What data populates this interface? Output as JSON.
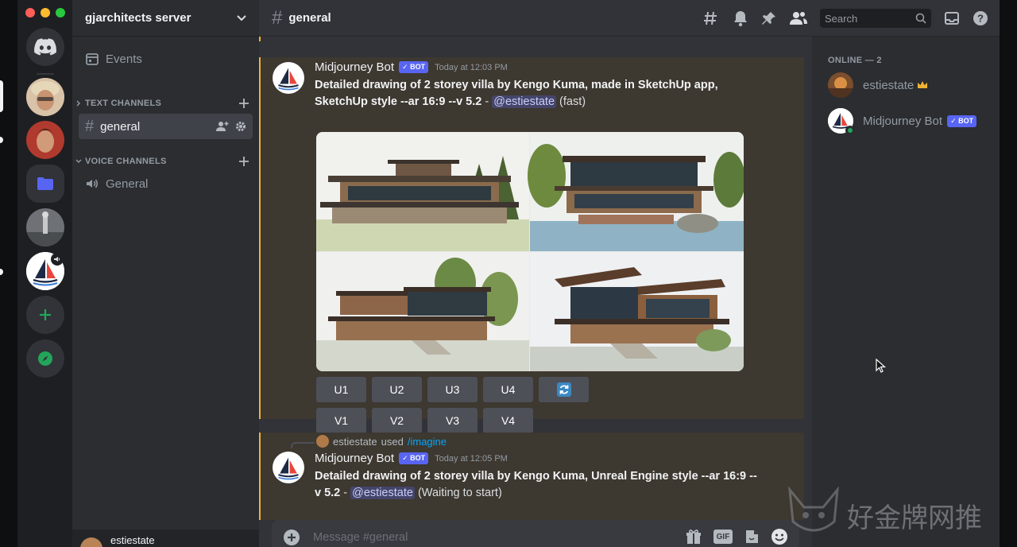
{
  "server": {
    "name": "gjarchitects server",
    "events_label": "Events",
    "text_category": "TEXT CHANNELS",
    "voice_category": "VOICE CHANNELS",
    "text_channels": [
      "general"
    ],
    "voice_channels": [
      "General"
    ]
  },
  "header": {
    "channel": "general",
    "search_placeholder": "Search"
  },
  "messages": [
    {
      "author": "Midjourney Bot",
      "bot_tag": "✓ BOT",
      "time": "Today at 12:03 PM",
      "prompt_line1": "Detailed drawing of 2 storey villa by Kengo Kuma, made in SketchUp app,",
      "prompt_line2": "SketchUp style --ar 16:9 --v 5.2",
      "sep": " - ",
      "mention": "@estiestate",
      "suffix": " (fast)",
      "upscale_buttons": [
        "U1",
        "U2",
        "U3",
        "U4"
      ],
      "variation_buttons": [
        "V1",
        "V2",
        "V3",
        "V4"
      ]
    },
    {
      "reply_user": "estiestate",
      "reply_used": "used",
      "reply_command": "/imagine",
      "author": "Midjourney Bot",
      "bot_tag": "✓ BOT",
      "time": "Today at 12:05 PM",
      "prompt_line1": "Detailed drawing of 2 storey villa by Kengo Kuma, Unreal Engine style --ar 16:9 --",
      "prompt_line2": "v 5.2",
      "sep": " - ",
      "mention": "@estiestate",
      "suffix": " (Waiting to start)"
    }
  ],
  "composer": {
    "placeholder": "Message #general",
    "gif_label": "GIF"
  },
  "members": {
    "online_label": "ONLINE — 2",
    "list": [
      {
        "name": "estiestate",
        "badge": "crown"
      },
      {
        "name": "Midjourney Bot",
        "tag": "✓ BOT"
      }
    ]
  },
  "user_panel": {
    "username": "estiestate"
  },
  "watermark_text": "好金牌网推",
  "colors": {
    "accent": "#5865f2",
    "highlight_border": "#f0b232",
    "online": "#23a55a",
    "add_server": "#23a55a"
  }
}
